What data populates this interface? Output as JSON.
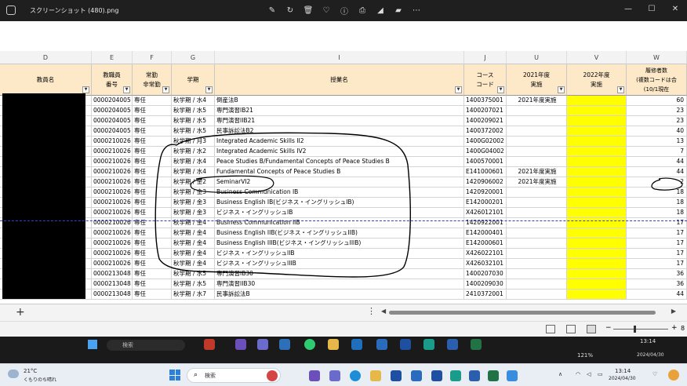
{
  "window": {
    "title": "スクリーンショット (480).png"
  },
  "columns": [
    {
      "letter": "D",
      "header": [
        "教員名"
      ]
    },
    {
      "letter": "E",
      "header": [
        "教職員",
        "番号"
      ]
    },
    {
      "letter": "F",
      "header": [
        "常勤",
        "非常勤"
      ]
    },
    {
      "letter": "G",
      "header": [
        "学期"
      ]
    },
    {
      "letter": "I",
      "header": [
        "授業名"
      ]
    },
    {
      "letter": "J",
      "header": [
        "コース",
        "コード"
      ]
    },
    {
      "letter": "U",
      "header": [
        "2021年度",
        "実施"
      ]
    },
    {
      "letter": "V",
      "header": [
        "2022年度",
        "実施"
      ]
    },
    {
      "letter": "W",
      "header": [
        "履修者数",
        "(複数コードは合",
        "(10/1現在"
      ]
    }
  ],
  "rows": [
    {
      "num": "0000204005",
      "type": "専任",
      "term": "秋学期 / 水4",
      "course": "倒産法B",
      "code": "1400375001",
      "y2021": "2021年度実施",
      "students": "60"
    },
    {
      "num": "0000204005",
      "type": "専任",
      "term": "秋学期 / 水5",
      "course": "専門演習IB21",
      "code": "1400207021",
      "y2021": "",
      "students": "23"
    },
    {
      "num": "0000204005",
      "type": "専任",
      "term": "秋学期 / 水5",
      "course": "専門演習IIB21",
      "code": "1400209021",
      "y2021": "",
      "students": "23"
    },
    {
      "num": "0000204005",
      "type": "専任",
      "term": "秋学期 / 水5",
      "course": "民事訴訟法B2",
      "code": "1400372002",
      "y2021": "",
      "students": "40"
    },
    {
      "num": "0000210026",
      "type": "専任",
      "term": "秋学期 / 月3",
      "course": "Integrated Academic Skills II2",
      "code": "1400G02002",
      "y2021": "",
      "students": "13"
    },
    {
      "num": "0000210026",
      "type": "専任",
      "term": "秋学期 / 水2",
      "course": "Integrated Academic Skills IV2",
      "code": "1400G04002",
      "y2021": "",
      "students": "7"
    },
    {
      "num": "0000210026",
      "type": "専任",
      "term": "秋学期 / 水4",
      "course": "Peace Studies B/Fundamental Concepts of Peace Studies B",
      "code": "1400570001",
      "y2021": "",
      "students": "44"
    },
    {
      "num": "0000210026",
      "type": "専任",
      "term": "秋学期 / 水4",
      "course": "Fundamental Concepts of Peace Studies B",
      "code": "E141000601",
      "y2021": "2021年度実施",
      "students": "44"
    },
    {
      "num": "0000210026",
      "type": "専任",
      "term": "秋学期 / 金2",
      "course": "SeminarVI2",
      "code": "1420906002",
      "y2021": "2021年度実施",
      "students": "2"
    },
    {
      "num": "0000210026",
      "type": "専任",
      "term": "秋学期 / 金3",
      "course": "Business Communication IB",
      "code": "1420920001",
      "y2021": "",
      "students": "18"
    },
    {
      "num": "0000210026",
      "type": "専任",
      "term": "秋学期 / 金3",
      "course": "Business English IB(ビジネス・イングリッシュIB)",
      "code": "E142000201",
      "y2021": "",
      "students": "18"
    },
    {
      "num": "0000210026",
      "type": "専任",
      "term": "秋学期 / 金3",
      "course": "ビジネス・イングリッシュIB",
      "code": "X426012101",
      "y2021": "",
      "students": "18"
    },
    {
      "num": "0000210026",
      "type": "専任",
      "term": "秋学期 / 金4",
      "course": "Business Communication IIB",
      "code": "1420922001",
      "y2021": "",
      "students": "17"
    },
    {
      "num": "0000210026",
      "type": "専任",
      "term": "秋学期 / 金4",
      "course": "Business English IIB(ビジネス・イングリッシュIIB)",
      "code": "E142000401",
      "y2021": "",
      "students": "17"
    },
    {
      "num": "0000210026",
      "type": "専任",
      "term": "秋学期 / 金4",
      "course": "Business English IIIB(ビジネス・イングリッシュIIIB)",
      "code": "E142000601",
      "y2021": "",
      "students": "17"
    },
    {
      "num": "0000210026",
      "type": "専任",
      "term": "秋学期 / 金4",
      "course": "ビジネス・イングリッシュIIB",
      "code": "X426022101",
      "y2021": "",
      "students": "17"
    },
    {
      "num": "0000210026",
      "type": "専任",
      "term": "秋学期 / 金4",
      "course": "ビジネス・イングリッシュIIIB",
      "code": "X426032101",
      "y2021": "",
      "students": "17"
    },
    {
      "num": "0000213048",
      "type": "専任",
      "term": "秋学期 / 水5",
      "course": "専門演習IB30",
      "code": "1400207030",
      "y2021": "",
      "students": "36"
    },
    {
      "num": "0000213048",
      "type": "専任",
      "term": "秋学期 / 水5",
      "course": "専門演習IIB30",
      "code": "1400209030",
      "y2021": "",
      "students": "36"
    },
    {
      "num": "0000213048",
      "type": "専任",
      "term": "秋学期 / 水7",
      "course": "民事訴訟法B",
      "code": "2410372001",
      "y2021": "",
      "students": "44"
    }
  ],
  "statusbar": {
    "zoom_short": "8"
  },
  "inner_taskbar": {
    "search": "検索",
    "time": "13:14",
    "date": "2024/04/30",
    "zoom": "121%"
  },
  "outer_taskbar": {
    "weather_temp": "21°C",
    "weather_desc": "くもりのち晴れ",
    "search": "検索",
    "time": "13:14",
    "date": "2024/04/30"
  },
  "icons": [
    "edit-icon",
    "rotate-icon",
    "delete-icon",
    "heart-icon",
    "info-icon",
    "print-icon",
    "crop-icon",
    "more-icon"
  ],
  "colors": {
    "header_fill": "#fde9c8",
    "highlight": "#ffff00",
    "annotation_ink": "#000000"
  }
}
